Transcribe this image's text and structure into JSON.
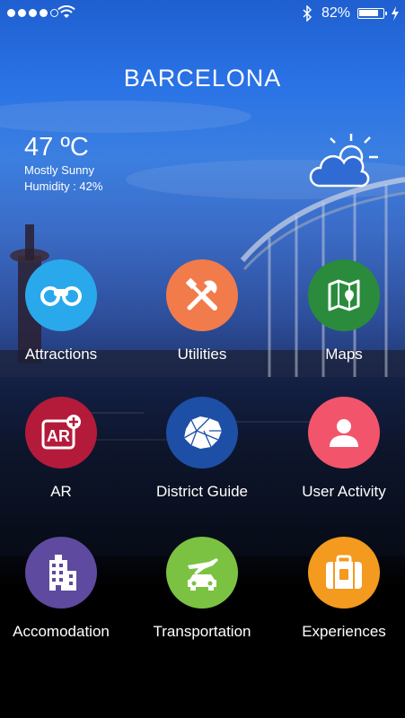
{
  "status_bar": {
    "battery_percent": "82%",
    "battery_level": 0.82,
    "signal_filled": 4,
    "signal_total": 5,
    "icons": [
      "wifi-icon",
      "bluetooth-icon",
      "battery-icon",
      "charging-icon"
    ]
  },
  "header": {
    "city": "BARCELONA"
  },
  "weather": {
    "temperature": "47 ºC",
    "condition": "Mostly Sunny",
    "humidity": "Humidity : 42%",
    "icon": "partly-sunny-icon"
  },
  "menu": [
    {
      "label": "Attractions",
      "color": "#29a9ec",
      "icon": "binoculars-icon"
    },
    {
      "label": "Utilities",
      "color": "#f27b4b",
      "icon": "tools-icon"
    },
    {
      "label": "Maps",
      "color": "#2a8b3c",
      "icon": "map-icon"
    },
    {
      "label": "AR",
      "color": "#b41b3a",
      "icon": "ar-icon"
    },
    {
      "label": "District Guide",
      "color": "#1d4fa6",
      "icon": "district-map-icon"
    },
    {
      "label": "User Activity",
      "color": "#f2556b",
      "icon": "user-icon"
    },
    {
      "label": "Accomodation",
      "color": "#5e4a9e",
      "icon": "building-icon"
    },
    {
      "label": "Transportation",
      "color": "#7cc242",
      "icon": "transport-icon"
    },
    {
      "label": "Experiences",
      "color": "#f39a1f",
      "icon": "suitcase-icon"
    }
  ]
}
